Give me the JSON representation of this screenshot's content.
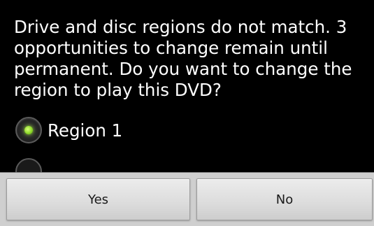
{
  "dialog": {
    "message": "Drive and disc regions do not match. 3 opportunities to change remain until permanent. Do you want to change the region to play this DVD?",
    "options": [
      {
        "label": "Region 1",
        "selected": true
      },
      {
        "label": "",
        "selected": false
      }
    ],
    "buttons": {
      "yes_label": "Yes",
      "no_label": "No"
    }
  },
  "colors": {
    "background": "#000000",
    "text": "#ffffff",
    "radio_selected": "#8fd92a",
    "button_bar": "#cfcfcf"
  }
}
